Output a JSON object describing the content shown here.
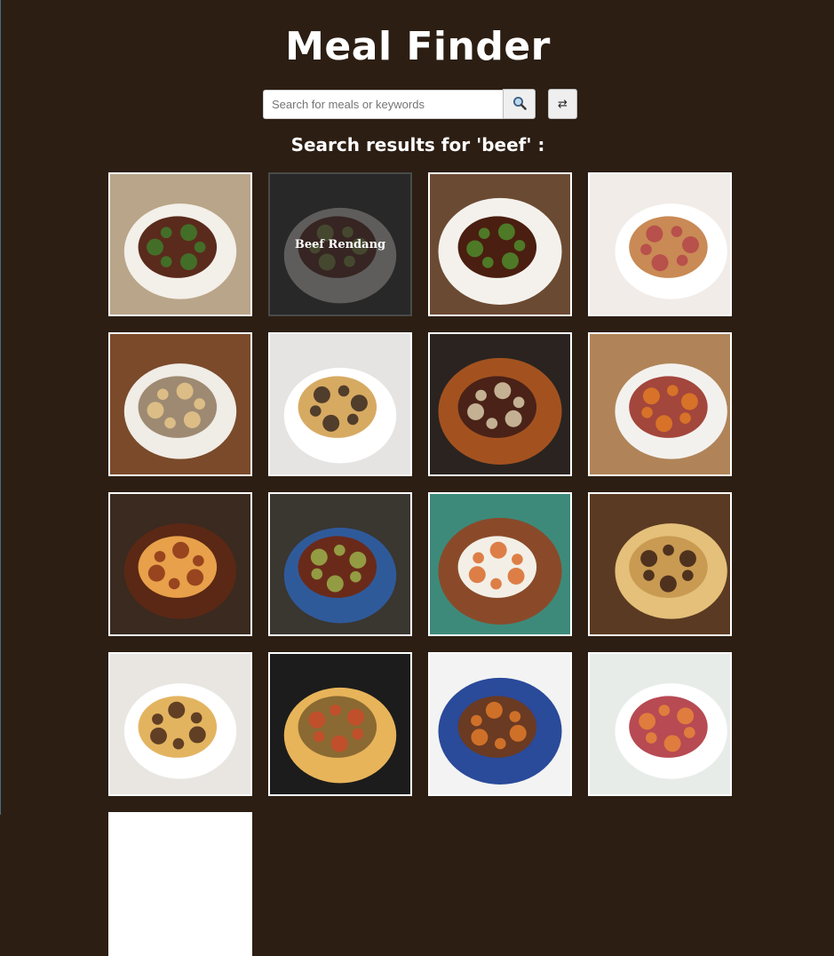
{
  "app": {
    "title": "Meal Finder"
  },
  "search": {
    "placeholder": "Search for meals or keywords",
    "value": "",
    "search_icon": "magnifier-icon",
    "random_icon": "shuffle-icon",
    "random_glyph": "⇄"
  },
  "results": {
    "heading": "Search results for 'beef' :",
    "meals": [
      {
        "name": "",
        "hovered": false,
        "palette": [
          "#b9a589",
          "#f3efe9",
          "#5a2a1c",
          "#3f7a2a"
        ]
      },
      {
        "name": "Beef Rendang",
        "hovered": true,
        "palette": [
          "#2a2a2a",
          "#eae6e1",
          "#5c1f12",
          "#9ab04a"
        ]
      },
      {
        "name": "",
        "hovered": false,
        "palette": [
          "#6b4a33",
          "#f4f1ec",
          "#4a1e10",
          "#4f8a2c"
        ]
      },
      {
        "name": "",
        "hovered": false,
        "palette": [
          "#f1ece8",
          "#ffffff",
          "#c98a55",
          "#b5454a"
        ]
      },
      {
        "name": "",
        "hovered": false,
        "palette": [
          "#7a4a2a",
          "#f0ece6",
          "#9e8a72",
          "#e6c68a"
        ]
      },
      {
        "name": "",
        "hovered": false,
        "palette": [
          "#e6e4e2",
          "#ffffff",
          "#d7aa62",
          "#3a2a22"
        ]
      },
      {
        "name": "",
        "hovered": false,
        "palette": [
          "#2a2320",
          "#a3521f",
          "#4a2218",
          "#d9c9a8"
        ]
      },
      {
        "name": "",
        "hovered": false,
        "palette": [
          "#b08458",
          "#f3f1ee",
          "#a3463c",
          "#e07a24"
        ]
      },
      {
        "name": "",
        "hovered": false,
        "palette": [
          "#3a2a20",
          "#5a2814",
          "#e8a04a",
          "#8a3418"
        ]
      },
      {
        "name": "",
        "hovered": false,
        "palette": [
          "#3a3630",
          "#2f5a9a",
          "#6a2a1a",
          "#9ab04a"
        ]
      },
      {
        "name": "",
        "hovered": false,
        "palette": [
          "#3d8a7a",
          "#8a4a2a",
          "#f3efe6",
          "#d86a2a"
        ]
      },
      {
        "name": "",
        "hovered": false,
        "palette": [
          "#5a3a22",
          "#e4c07a",
          "#c99a52",
          "#3a2014"
        ]
      },
      {
        "name": "",
        "hovered": false,
        "palette": [
          "#e9e6e2",
          "#ffffff",
          "#e3b460",
          "#4a2a1a"
        ]
      },
      {
        "name": "",
        "hovered": false,
        "palette": [
          "#1c1c1c",
          "#e8b45a",
          "#8a6a32",
          "#c94a2a"
        ]
      },
      {
        "name": "",
        "hovered": false,
        "palette": [
          "#f3f3f3",
          "#2a4a9a",
          "#6a3a22",
          "#e07a2a"
        ]
      },
      {
        "name": "",
        "hovered": false,
        "palette": [
          "#e8ece9",
          "#ffffff",
          "#b74a52",
          "#e8853a"
        ]
      },
      {
        "name": "",
        "hovered": false,
        "palette": [
          "#ffffff",
          "#ffffff",
          "#ffffff",
          "#ffffff"
        ]
      }
    ]
  }
}
